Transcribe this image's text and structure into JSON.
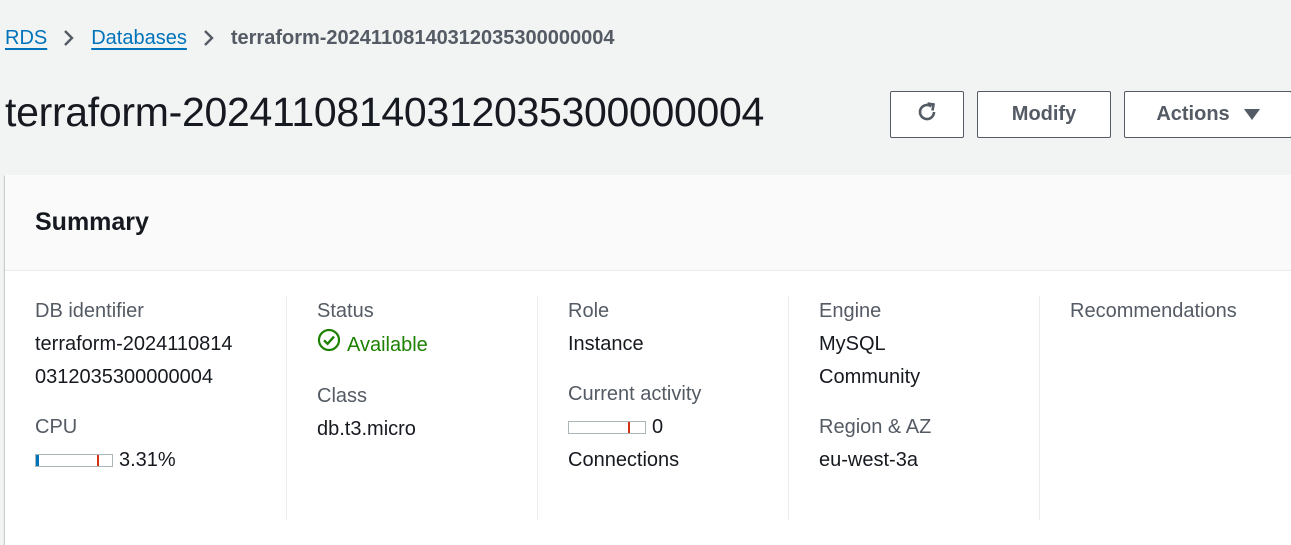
{
  "breadcrumb": {
    "items": [
      {
        "label": "RDS"
      },
      {
        "label": "Databases"
      }
    ],
    "current": "terraform-20241108140312035300000004"
  },
  "page": {
    "title": "terraform-20241108140312035300000004"
  },
  "header_actions": {
    "refresh_icon": "refresh-icon",
    "modify_label": "Modify",
    "actions_label": "Actions",
    "actions_icon": "caret-down-icon"
  },
  "summary": {
    "title": "Summary",
    "db_identifier": {
      "label": "DB identifier",
      "value": "terraform-20241108140312035300000004"
    },
    "cpu": {
      "label": "CPU",
      "value": "3.31%",
      "fraction": 0.0331
    },
    "status": {
      "label": "Status",
      "value": "Available",
      "icon": "check-circle-icon",
      "color": "#1d8102"
    },
    "class": {
      "label": "Class",
      "value": "db.t3.micro"
    },
    "role": {
      "label": "Role",
      "value": "Instance"
    },
    "current_activity": {
      "label": "Current activity",
      "value": "0",
      "unit": "Connections",
      "fraction": 0
    },
    "engine": {
      "label": "Engine",
      "value": "MySQL Community"
    },
    "region_az": {
      "label": "Region & AZ",
      "value": "eu-west-3a"
    },
    "recommendations": {
      "label": "Recommendations",
      "value": ""
    }
  },
  "colors": {
    "link": "#0073bb",
    "success": "#1d8102",
    "meter_threshold": "#d13212"
  }
}
